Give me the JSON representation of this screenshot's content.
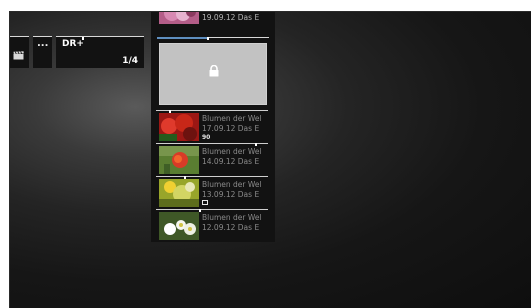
{
  "toolbar": {
    "clapper_icon": "clapperboard-icon",
    "more_label": "...",
    "dr_label": "DR+",
    "page_indicator": "1/4"
  },
  "list": {
    "top_item": {
      "date": "19.09.12 Das E"
    },
    "locked_item": {
      "icon": "lock-icon",
      "progress": 0.45
    },
    "items": [
      {
        "title": "Blumen der Wel",
        "date": "17.09.12 Das E",
        "badge": "90",
        "progress": 0.12
      },
      {
        "title": "Blumen der Wel",
        "date": "14.09.12 Das E",
        "badge": "",
        "progress": 0.88
      },
      {
        "title": "Blumen der Wel",
        "date": "13.09.12 Das E",
        "badge": "",
        "progress": 0.25
      },
      {
        "title": "Blumen der Wel",
        "date": "12.09.12 Das E",
        "badge": "",
        "progress": 0.38
      }
    ]
  },
  "colors": {
    "panel_background": "#121212",
    "locked_panel": "#c2c2c2",
    "progress_accent": "#5f8fc0",
    "secondary_text": "#8a8a8a"
  }
}
